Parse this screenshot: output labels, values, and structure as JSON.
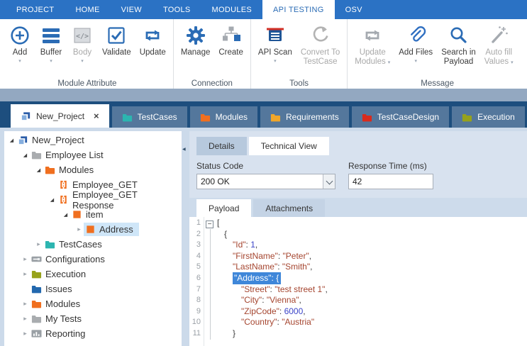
{
  "colors": {
    "header_blue": "#2b72c4",
    "icon_blue": "#2b6cb5",
    "disabled_gray": "#a5aab0",
    "band": "#93a8c1",
    "tabbar_navy": "#1d4e7e",
    "tab_inactive": "#54779c",
    "tree_selection": "#cfe6f8",
    "code_selection": "#3f87d9",
    "json_red": "#a5452f",
    "json_blue": "#3b44c8",
    "folder_teal": "#2cb5b0",
    "folder_orange": "#f06f1f",
    "folder_amber": "#f0a62a",
    "folder_red": "#d92b1d",
    "folder_olive": "#97a21b",
    "folder_gray": "#a9acaf",
    "folder_blue": "#2268ae"
  },
  "glyphs": {
    "caret": "▾",
    "close": "×",
    "collapse_left": "◀",
    "tree_collapsed": "▸",
    "tree_expanded": "◢",
    "fold_minus": "−"
  },
  "ribbon": {
    "tabs": [
      {
        "label": "PROJECT"
      },
      {
        "label": "HOME"
      },
      {
        "label": "VIEW"
      },
      {
        "label": "TOOLS"
      },
      {
        "label": "MODULES"
      },
      {
        "label": "API TESTING",
        "active": true
      },
      {
        "label": "OSV"
      }
    ],
    "groups": [
      {
        "label": "Module Attribute",
        "buttons": [
          {
            "label": "Add",
            "icon": "add-icon",
            "caret": "below",
            "enabled": true
          },
          {
            "label": "Buffer",
            "icon": "buffer-icon",
            "caret": "below",
            "enabled": true
          },
          {
            "label": "Body",
            "icon": "body-icon",
            "caret": "below",
            "enabled": false
          },
          {
            "label": "Validate",
            "icon": "validate-icon",
            "enabled": true
          },
          {
            "label": "Update",
            "icon": "update-icon",
            "enabled": true
          }
        ]
      },
      {
        "label": "Connection",
        "buttons": [
          {
            "label": "Manage",
            "icon": "gear-icon",
            "enabled": true
          },
          {
            "label": "Create",
            "icon": "sitemap-icon",
            "enabled": true
          }
        ]
      },
      {
        "label": "Tools",
        "buttons": [
          {
            "label": "API Scan",
            "icon": "api-scan-icon",
            "caret": "below",
            "enabled": true
          },
          {
            "label": "Convert To\nTestCase",
            "icon": "convert-icon",
            "enabled": false
          }
        ]
      },
      {
        "label": "Message",
        "buttons": [
          {
            "label": "Update\nModules",
            "icon": "update-modules-icon",
            "caret": "inline",
            "enabled": false
          },
          {
            "label": "Add Files",
            "icon": "paperclip-icon",
            "caret": "below",
            "enabled": true
          },
          {
            "label": "Search in\nPayload",
            "icon": "search-icon",
            "enabled": true
          },
          {
            "label": "Auto fill\nValues",
            "icon": "wand-icon",
            "caret": "inline",
            "enabled": false
          }
        ]
      }
    ]
  },
  "document_tabs": [
    {
      "label": "New_Project",
      "icon": "project-icon",
      "active": true,
      "closable": true
    },
    {
      "label": "TestCases",
      "icon": "folder-icon",
      "color": "#2cb5b0"
    },
    {
      "label": "Modules",
      "icon": "folder-icon",
      "color": "#f06f1f"
    },
    {
      "label": "Requirements",
      "icon": "folder-icon",
      "color": "#f0a62a"
    },
    {
      "label": "TestCaseDesign",
      "icon": "folder-icon",
      "color": "#d92b1d"
    },
    {
      "label": "Execution",
      "icon": "folder-icon",
      "color": "#97a21b"
    }
  ],
  "tree": {
    "items": [
      {
        "label": "New_Project",
        "level": 0,
        "expand": "expanded",
        "icon": "project-icon"
      },
      {
        "label": "Employee List",
        "level": 1,
        "expand": "expanded",
        "icon": "folder-icon",
        "color": "#a9acaf"
      },
      {
        "label": "Modules",
        "level": 2,
        "expand": "expanded",
        "icon": "folder-icon",
        "color": "#f06f1f"
      },
      {
        "label": "Employee_GET",
        "level": 3,
        "expand": "none",
        "icon": "module-icon"
      },
      {
        "label": "Employee_GET Response",
        "level": 3,
        "expand": "expanded",
        "icon": "module-icon"
      },
      {
        "label": "item",
        "level": 4,
        "expand": "expanded",
        "icon": "square-icon",
        "color": "#f06f1f"
      },
      {
        "label": "Address",
        "level": 5,
        "expand": "collapsed",
        "icon": "square-icon",
        "color": "#f06f1f",
        "selected": true
      },
      {
        "label": "TestCases",
        "level": 2,
        "expand": "collapsed",
        "icon": "folder-icon",
        "color": "#2cb5b0"
      },
      {
        "label": "Configurations",
        "level": 1,
        "expand": "collapsed",
        "icon": "config-icon"
      },
      {
        "label": "Execution",
        "level": 1,
        "expand": "collapsed",
        "icon": "folder-icon",
        "color": "#97a21b"
      },
      {
        "label": "Issues",
        "level": 1,
        "expand": "none",
        "icon": "folder-icon",
        "color": "#2268ae"
      },
      {
        "label": "Modules",
        "level": 1,
        "expand": "collapsed",
        "icon": "folder-icon",
        "color": "#f06f1f"
      },
      {
        "label": "My Tests",
        "level": 1,
        "expand": "collapsed",
        "icon": "folder-icon",
        "color": "#a9acaf"
      },
      {
        "label": "Reporting",
        "level": 1,
        "expand": "collapsed",
        "icon": "report-icon"
      }
    ]
  },
  "panel": {
    "view_tabs": [
      {
        "label": "Details",
        "active": false
      },
      {
        "label": "Technical View",
        "active": true
      }
    ],
    "status_code": {
      "label": "Status Code",
      "value": "200 OK"
    },
    "response_time": {
      "label": "Response Time (ms)",
      "value": "42"
    },
    "payload_tabs": [
      {
        "label": "Payload",
        "active": true
      },
      {
        "label": "Attachments",
        "active": false
      }
    ],
    "code": {
      "lines": [
        {
          "n": 1,
          "indent": 0,
          "fold": true,
          "segments": [
            {
              "t": "[",
              "c": "pun"
            }
          ]
        },
        {
          "n": 2,
          "indent": 1,
          "segments": [
            {
              "t": "{",
              "c": "pun"
            }
          ]
        },
        {
          "n": 3,
          "indent": 2,
          "segments": [
            {
              "t": "\"Id\"",
              "c": "key"
            },
            {
              "t": ": ",
              "c": "pun"
            },
            {
              "t": "1",
              "c": "num"
            },
            {
              "t": ",",
              "c": "pun"
            }
          ]
        },
        {
          "n": 4,
          "indent": 2,
          "segments": [
            {
              "t": "\"FirstName\"",
              "c": "key"
            },
            {
              "t": ": ",
              "c": "pun"
            },
            {
              "t": "\"Peter\"",
              "c": "str"
            },
            {
              "t": ",",
              "c": "pun"
            }
          ]
        },
        {
          "n": 5,
          "indent": 2,
          "segments": [
            {
              "t": "\"LastName\"",
              "c": "key"
            },
            {
              "t": ": ",
              "c": "pun"
            },
            {
              "t": "\"Smith\"",
              "c": "str"
            },
            {
              "t": ",",
              "c": "pun"
            }
          ]
        },
        {
          "n": 6,
          "indent": 2,
          "segments": [
            {
              "t": "\"Address\": {",
              "c": "sel"
            }
          ]
        },
        {
          "n": 7,
          "indent": 3,
          "segments": [
            {
              "t": "\"Street\"",
              "c": "key"
            },
            {
              "t": ": ",
              "c": "pun"
            },
            {
              "t": "\"test street 1\"",
              "c": "str"
            },
            {
              "t": ",",
              "c": "pun"
            }
          ]
        },
        {
          "n": 8,
          "indent": 3,
          "segments": [
            {
              "t": "\"City\"",
              "c": "key"
            },
            {
              "t": ": ",
              "c": "pun"
            },
            {
              "t": "\"Vienna\"",
              "c": "str"
            },
            {
              "t": ",",
              "c": "pun"
            }
          ]
        },
        {
          "n": 9,
          "indent": 3,
          "segments": [
            {
              "t": "\"ZipCode\"",
              "c": "key"
            },
            {
              "t": ": ",
              "c": "pun"
            },
            {
              "t": "6000",
              "c": "num"
            },
            {
              "t": ",",
              "c": "pun"
            }
          ]
        },
        {
          "n": 10,
          "indent": 3,
          "segments": [
            {
              "t": "\"Country\"",
              "c": "key"
            },
            {
              "t": ": ",
              "c": "pun"
            },
            {
              "t": "\"Austria\"",
              "c": "str"
            }
          ]
        },
        {
          "n": 11,
          "indent": 2,
          "segments": [
            {
              "t": "}",
              "c": "pun"
            }
          ]
        }
      ]
    }
  }
}
